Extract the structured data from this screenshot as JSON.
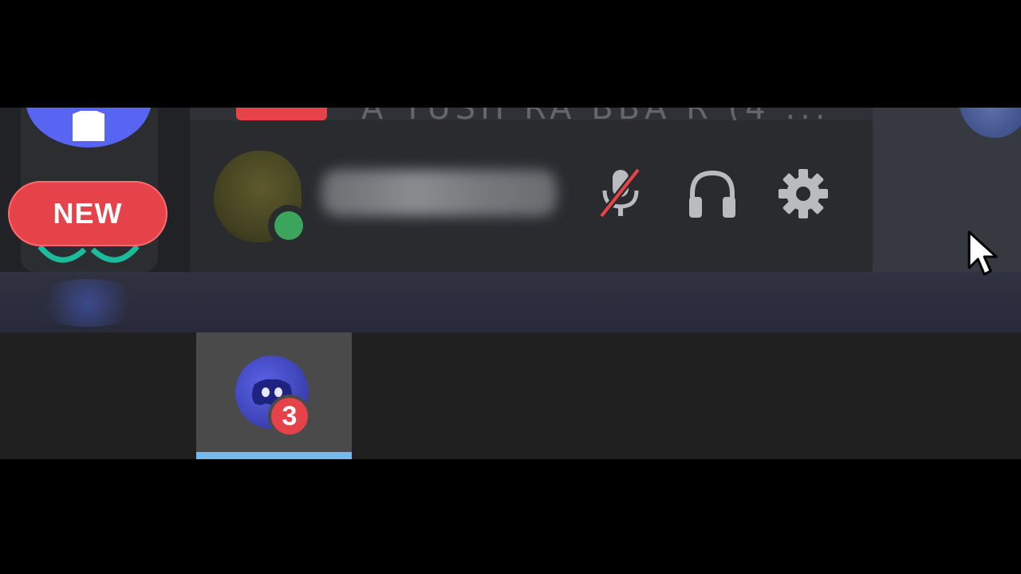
{
  "server_rail": {
    "new_badge": "NEW",
    "top_icon": "discord-server-icon",
    "bottom_icon": "server-icon"
  },
  "channel_peek": {
    "text": "A YUSH RA BBA R (4 ..."
  },
  "user_panel": {
    "status": "online",
    "status_color": "#3ba55d",
    "mic_state": "muted",
    "icons": {
      "mic": "mic-muted-icon",
      "headset": "headphones-icon",
      "settings": "gear-icon"
    }
  },
  "taskbar": {
    "app_icon": "discord-icon",
    "notification_count": "3",
    "indicator_color": "#76b9ed"
  },
  "colors": {
    "discord_blurple": "#5865f2",
    "alert_red": "#e5424a",
    "online_green": "#3ba55d"
  }
}
